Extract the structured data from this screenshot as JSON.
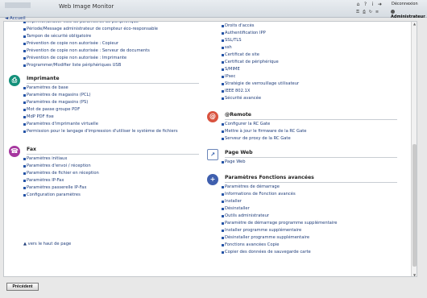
{
  "header": {
    "title": "Web Image Monitor",
    "logout_label": "Déconnexion",
    "user_label": "Administrateur",
    "icons": [
      "home-icon",
      "help-icon",
      "info-icon",
      "logout-icon"
    ]
  },
  "nav": {
    "back_label": "◄ Accueil"
  },
  "left_top_items": [
    "Imprimer/Effacer liste de paramètres de périphérique",
    "Période/Message administrateur de compteur éco-responsable",
    "Tampon de sécurité obligatoire",
    "Prévention de copie non autorisée : Copieur",
    "Prévention de copie non autorisée : Serveur de documents",
    "Prévention de copie non autorisée : Imprimante",
    "Programmer/Modifier liste périphériques USB"
  ],
  "printer": {
    "title": "Imprimante",
    "items": [
      "Paramètres de base",
      "Paramètres de magasins (PCL)",
      "Paramètres de magasins (PS)",
      "Mot de passe groupe PDF",
      "MdP PDF fixe",
      "Paramètres d'imprimante virtuelle",
      "Permission pour le langage d'impression d'utiliser le système de fichiers"
    ]
  },
  "fax": {
    "title": "Fax",
    "items": [
      "Paramètres initiaux",
      "Paramètres d'envoi / réception",
      "Paramètres de fichier en réception",
      "Paramètres IP-Fax",
      "Paramètres passerelle IP-Fax",
      "Configuration paramètres"
    ]
  },
  "right_top_items": [
    "Droits d'accès",
    "Authentification IPP",
    "SSL/TLS",
    "ssh",
    "Certificat de site",
    "Certificat de périphérique",
    "S/MIME",
    "IPsec",
    "Stratégie de verrouillage utilisateur",
    "IEEE 802.1X",
    "Sécurité avancée"
  ],
  "remote": {
    "title": "@Remote",
    "items": [
      "Configurer la RC Gate",
      "Mettre à jour le firmware de la RC Gate",
      "Serveur de proxy de la RC Gate"
    ]
  },
  "webpage": {
    "title": "Page Web",
    "items": [
      "Page Web"
    ]
  },
  "advanced": {
    "title": "Paramètres Fonctions avancées",
    "items": [
      "Paramètres de démarrage",
      "Informations de Fonction avancés",
      "Installer",
      "Désinstaller",
      "Outils administrateur",
      "Paramètre de démarrage programme supplémentaire",
      "Installer programme supplémentaire",
      "Désinstaller programme supplémentaire",
      "Fonctions avancées Copie",
      "Copier des données de sauvegarde carte"
    ]
  },
  "page_top_label": "▲ vers le haut de page",
  "footer": {
    "previous_label": "Précédent"
  }
}
